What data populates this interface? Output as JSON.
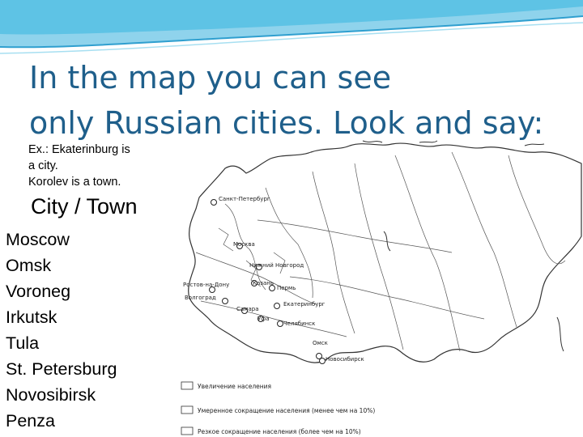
{
  "slide": {
    "title_line1": "In the map you can see",
    "title_line2": "only Russian cities. Look and say:",
    "example_line1": "Ex.: Ekaterinburg is",
    "example_line2": "a city.",
    "example_line3": "Korolev is a town.",
    "column_header": "City / Town",
    "cities": [
      "Moscow",
      "Omsk",
      "Voroneg",
      "Irkutsk",
      "Tula",
      "St. Petersburg",
      "Novosibirsk",
      "Penza"
    ],
    "title_color": "#1f5f8b",
    "accent_color": "#4db6dc"
  },
  "map": {
    "labels": [
      "Санкт-Петербург",
      "Москва",
      "Нижний Новгород",
      "Казань",
      "Ростов-на-Дону",
      "Волгоград",
      "Пермь",
      "Самара",
      "Екатеринбург",
      "Уфа",
      "Челябинск",
      "Омск",
      "Новосибирск"
    ],
    "legend": [
      "Увеличение населения",
      "Умеренное сокращение населения (менее чем на 10%)",
      "Резкое сокращение населения (более чем на 10%)"
    ]
  }
}
